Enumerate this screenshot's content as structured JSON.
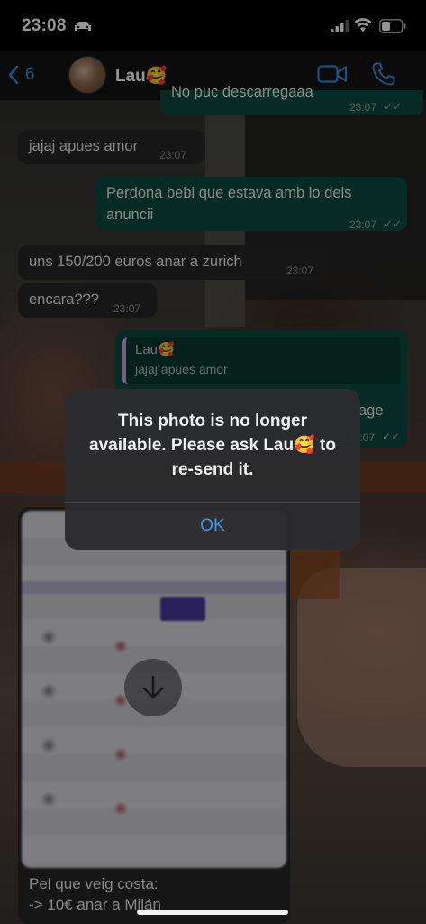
{
  "status_bar": {
    "time": "23:08"
  },
  "header": {
    "back_count": "6",
    "contact_name": "Lau🥰"
  },
  "messages": [
    {
      "direction": "outgoing",
      "text": "No puc descarregaaa",
      "time": "23:07"
    },
    {
      "direction": "incoming",
      "text": "jajaj apues amor",
      "time": "23:07"
    },
    {
      "direction": "outgoing",
      "text_line1": "Perdona bebi que estava amb lo dels",
      "text_line2": "anuncii",
      "time": "23:07"
    },
    {
      "direction": "incoming",
      "text": "uns 150/200 euros anar a zurich",
      "time": "23:07"
    },
    {
      "direction": "incoming",
      "text": "encara???",
      "time": "23:07"
    },
    {
      "direction": "outgoing",
      "quote_author": "Lau🥰",
      "quote_text": "jajaj apues amor",
      "text": "age",
      "time": "23:07"
    }
  ],
  "image_message": {
    "caption_line1": "Pel que veig costa:",
    "caption_line2": "-> 10€ anar a Milán"
  },
  "alert": {
    "message": "This photo is no longer available. Please ask Lau🥰 to re-send it.",
    "ok_label": "OK"
  },
  "colors": {
    "accent": "#2f8ed8",
    "outgoing_bubble": "#0b4a3e",
    "incoming_bubble": "#262626",
    "quote_bar": "#c9a4e0"
  }
}
